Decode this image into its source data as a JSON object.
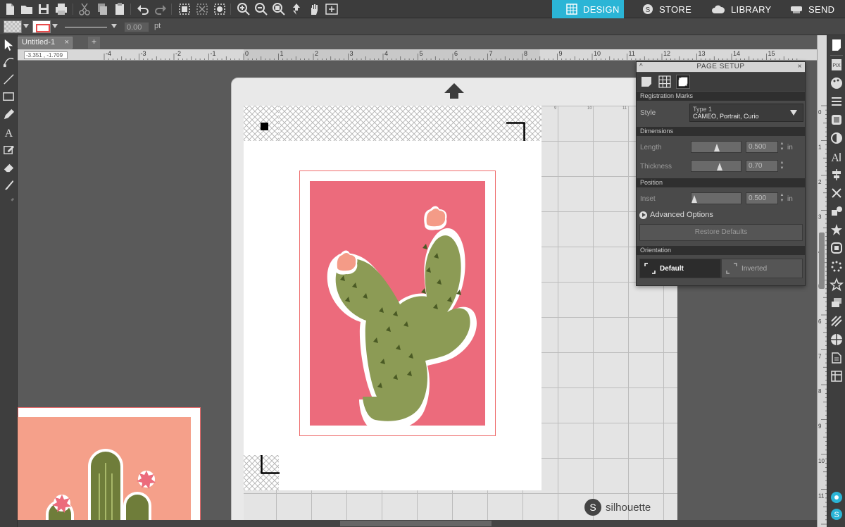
{
  "nav": {
    "design": "DESIGN",
    "store": "STORE",
    "library": "LIBRARY",
    "send": "SEND",
    "accent_color": "#2bb5d6"
  },
  "toolbar2": {
    "line_weight_value": "0.00",
    "line_weight_unit": "pt"
  },
  "document": {
    "tab_title": "Untitled-1",
    "close_glyph": "×",
    "add_tab_glyph": "+",
    "cursor_coords": "-3.351 , -1.709"
  },
  "ruler": {
    "h_ticks": [
      "-4",
      "-3",
      "-2",
      "-1",
      "0",
      "1",
      "2",
      "3",
      "4",
      "5",
      "6",
      "7",
      "8",
      "9",
      "10",
      "11",
      "12",
      "13",
      "14",
      "15"
    ],
    "v_ticks": [
      "0",
      "1",
      "2",
      "3",
      "4",
      "5",
      "6",
      "7",
      "8",
      "9",
      "10",
      "11",
      "12"
    ],
    "grid_labels": [
      "9",
      "10",
      "11"
    ]
  },
  "mat": {
    "brand": "silhouette",
    "brand_glyph": "S",
    "card_color": "#ec6b7c",
    "cactus_color": "#8c9b55",
    "flower_color": "#f49b87"
  },
  "page_setup": {
    "title": "PAGE SETUP",
    "collapse_glyph": "^",
    "close_glyph": "×",
    "sections": {
      "registration": "Registration Marks",
      "dimensions": "Dimensions",
      "position": "Position",
      "orientation": "Orientation"
    },
    "style_label": "Style",
    "style_value_line1": "Type 1",
    "style_value_line2": "CAMEO, Portrait, Curio",
    "length_label": "Length",
    "length_value": "0.500",
    "thickness_label": "Thickness",
    "thickness_value": "0.70",
    "inset_label": "Inset",
    "inset_value": "0.500",
    "unit": "in",
    "advanced": "Advanced Options",
    "restore": "Restore Defaults",
    "orient_default": "Default",
    "orient_inverted": "Inverted"
  }
}
